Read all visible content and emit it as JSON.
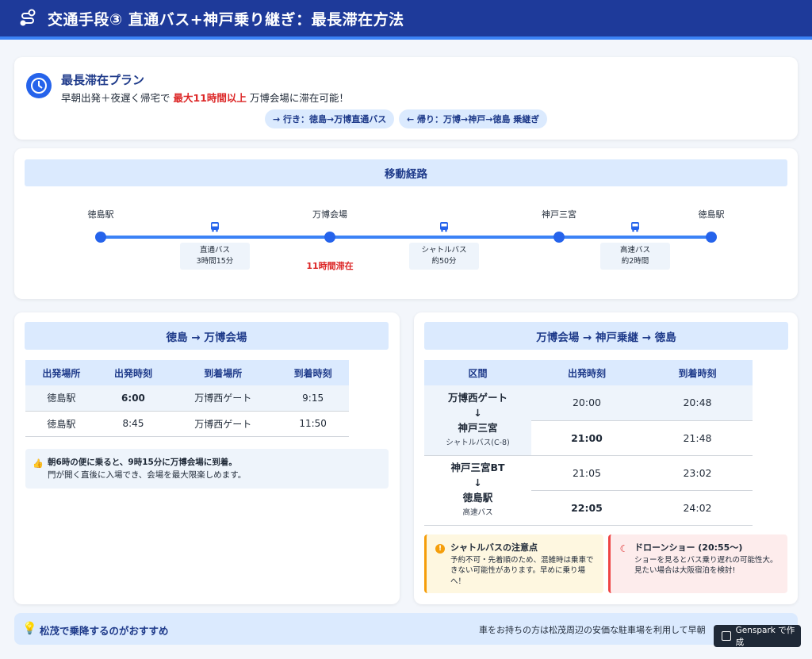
{
  "header": {
    "title": "交通手段③ 直通バス+神戸乗り継ぎ：最長滞在方法",
    "icon": "route-icon"
  },
  "plan": {
    "title": "最長滞在プラン",
    "desc_prefix": "早朝出発＋夜遅く帰宅で",
    "desc_highlight": "最大11時間以上",
    "desc_suffix": "万博会場に滞在可能！",
    "chip_outbound": "→ 行き：徳島→万博直通バス",
    "chip_return": "← 帰り：万博→神戸→徳島 乗継ぎ"
  },
  "route": {
    "title": "移動経路",
    "stations": [
      "徳島駅",
      "万博会場",
      "神戸三宮",
      "徳島駅"
    ],
    "segments": [
      {
        "name": "直通バス",
        "time": "3時間15分"
      },
      {
        "name": "シャトルバス",
        "time": "約50分"
      },
      {
        "name": "高速バス",
        "time": "約2時間"
      }
    ],
    "stay_label": "11時間滞在"
  },
  "outbound": {
    "title": "徳島 → 万博会場",
    "headers": [
      "出発場所",
      "出発時刻",
      "到着場所",
      "到着時刻"
    ],
    "rows": [
      [
        "徳島駅",
        "6:00",
        "万博西ゲート",
        "9:15"
      ],
      [
        "徳島駅",
        "8:45",
        "万博西ゲート",
        "11:50"
      ]
    ],
    "note_line1": "朝6時の便に乗ると、9時15分に万博会場に到着。",
    "note_line2": "門が開く直後に入場でき、会場を最大限楽しめます。"
  },
  "return": {
    "title": "万博会場 → 神戸乗継 → 徳島",
    "headers": [
      "区間",
      "出発時刻",
      "到着時刻"
    ],
    "section1": {
      "from": "万博西ゲート",
      "arrow": "↓",
      "to": "神戸三宮",
      "type": "シャトルバス(C-8)"
    },
    "section2": {
      "from": "神戸三宮BT",
      "arrow": "↓",
      "to": "徳島駅",
      "type": "高速バス"
    },
    "times": [
      [
        "20:00",
        "20:48"
      ],
      [
        "21:00",
        "21:48"
      ],
      [
        "21:05",
        "23:02"
      ],
      [
        "22:05",
        "24:02"
      ]
    ]
  },
  "warnings": {
    "shuttle_title": "シャトルバスの注意点",
    "shuttle_text": "予約不可・先着順のため、混雑時は乗車できない可能性があります。早めに乗り場へ！",
    "drone_title": "ドローンショー (20:55〜)",
    "drone_text": "ショーを見るとバス乗り遅れの可能性大。見たい場合は大阪宿泊を検討!"
  },
  "bottom": {
    "title": "松茂で乗降するのがおすすめ",
    "note": "車をお持ちの方は松茂周辺の安価な駐車場を利用して早朝"
  },
  "badge": {
    "label": "Genspark で作成"
  },
  "colors": {
    "header": "#1e3a9a",
    "accent": "#2563eb",
    "highlight": "#dc2626"
  }
}
